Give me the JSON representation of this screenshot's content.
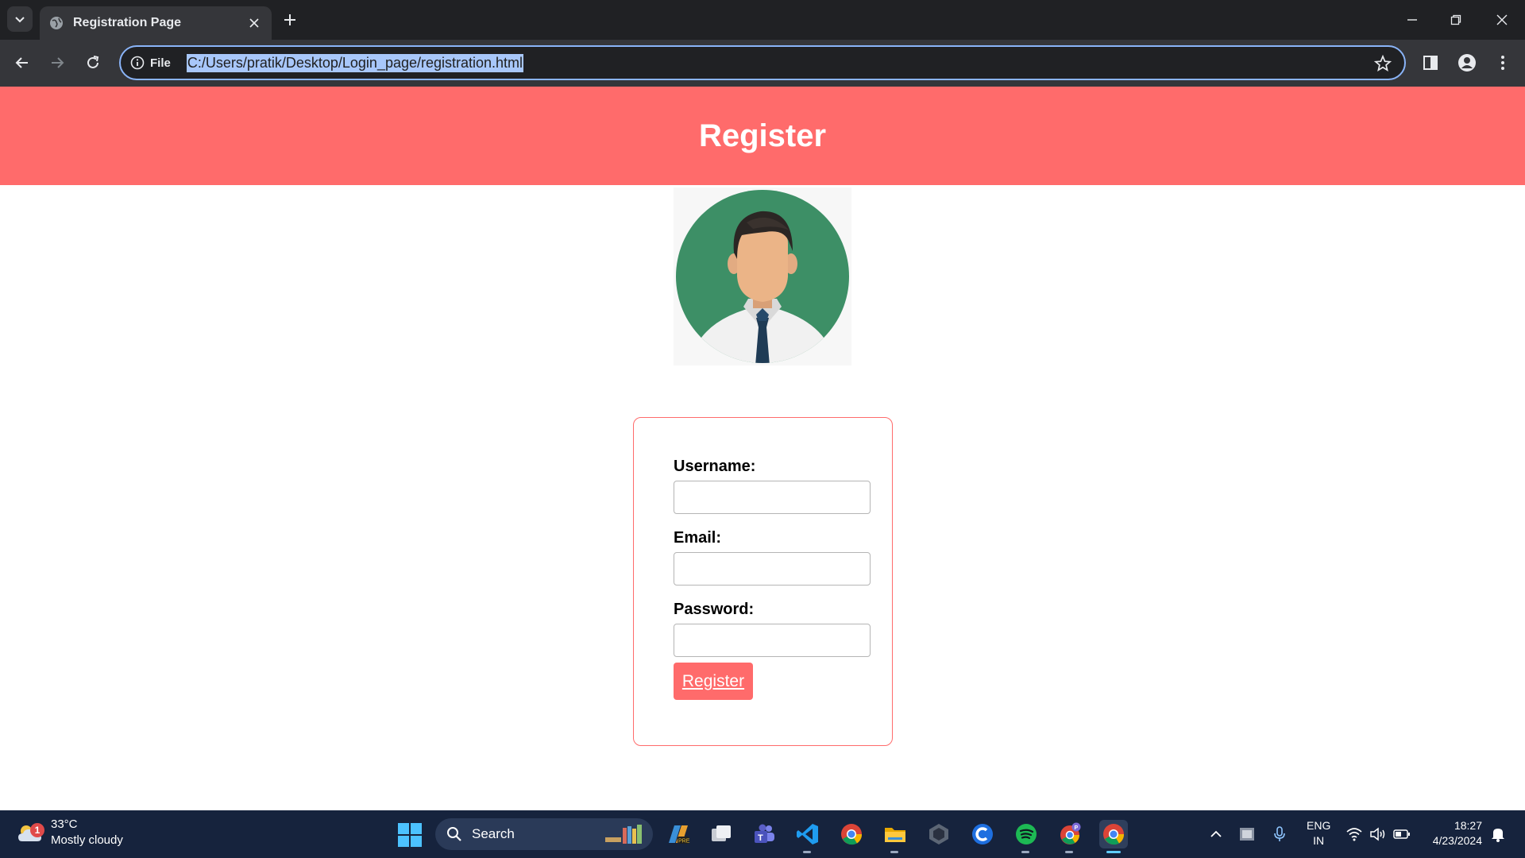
{
  "browser": {
    "tab_title": "Registration Page",
    "site_chip_label": "File",
    "url": "C:/Users/pratik/Desktop/Login_page/registration.html"
  },
  "page": {
    "header_title": "Register",
    "form": {
      "username_label": "Username:",
      "email_label": "Email:",
      "password_label": "Password:",
      "username_value": "",
      "email_value": "",
      "password_value": "",
      "submit_label": "Register"
    },
    "colors": {
      "accent": "#ff6b6b",
      "avatar_bg": "#3d8f66"
    }
  },
  "taskbar": {
    "weather_temp": "33°C",
    "weather_desc": "Mostly cloudy",
    "weather_badge": "1",
    "search_label": "Search",
    "lang_line1": "ENG",
    "lang_line2": "IN",
    "time": "18:27",
    "date": "4/23/2024",
    "apps": [
      "powertoys-icon",
      "task-view-icon",
      "teams-icon",
      "vscode-icon",
      "chrome-icon",
      "file-explorer-icon",
      "unity-icon",
      "c-app-icon",
      "spotify-icon",
      "chrome-profile-icon",
      "chrome-active-icon"
    ]
  }
}
